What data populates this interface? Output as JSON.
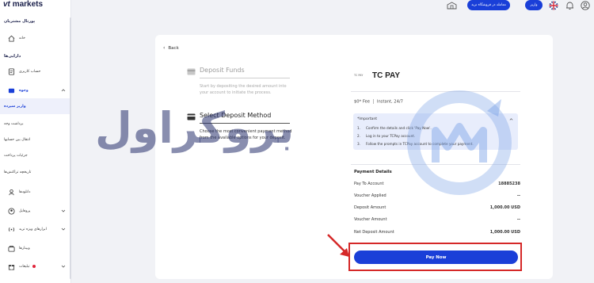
{
  "brand": {
    "logo_prefix": "vt",
    "logo_suffix": "markets"
  },
  "sidebar": {
    "portal_title": "پورتال مشتریان",
    "items": [
      {
        "label": "خانه",
        "icon": "home-icon"
      },
      {
        "heading": "دارایی‌ها"
      },
      {
        "label": "حساب کاربری",
        "icon": "account-icon"
      },
      {
        "label": "وجوه",
        "icon": "wallet-icon",
        "expandable": true
      },
      {
        "label": "واریز سپرده",
        "active": true
      },
      {
        "label": "برداشت وجه"
      },
      {
        "label": "انتقال بین حسابها"
      },
      {
        "label": "جزئیات پرداخت"
      },
      {
        "label": "تاریخچه تراکنش‌ها"
      },
      {
        "label": "دانلودها",
        "icon": "download-icon"
      },
      {
        "label": "پروفایل",
        "icon": "profile-icon",
        "expandable": true
      },
      {
        "label": "ابزارهای ویژه ترید",
        "icon": "signal-icon",
        "expandable": true
      },
      {
        "label": "وبینارها",
        "icon": "webinar-icon"
      },
      {
        "label": "تبلیغات",
        "icon": "gift-icon",
        "expandable": true,
        "badge_color": "#e0243b"
      }
    ]
  },
  "topbar": {
    "trade_button": "معامله در فروشگاه ترید",
    "deposit_button": "واریز",
    "language": "English",
    "notifications_icon": "bell-icon",
    "user_icon": "user-circle-icon"
  },
  "card": {
    "back_label": "Back",
    "steps": [
      {
        "title": "Deposit Funds",
        "description": "Start by depositing the desired amount into your account to initiate the process.",
        "active": false
      },
      {
        "title": "Select Deposit Method",
        "description": "Choose the most convenient payment method from the available options for your deposit.",
        "active": true
      }
    ],
    "method": {
      "logo_text": "TC PAY",
      "name": "TC PAY",
      "fee": "$0* Fee",
      "speed": "Instant, 24/7"
    },
    "important": {
      "title": "*Important",
      "steps": [
        {
          "n": "1.",
          "text": "Confirm the details and click 'Pay Now'."
        },
        {
          "n": "2.",
          "text": "Log in to your TCPay account."
        },
        {
          "n": "3.",
          "text": "Follow the prompts in TCPay account to complete your payment."
        }
      ]
    },
    "payment_details": {
      "title": "Payment Details",
      "rows": [
        {
          "label": "Pay To Account",
          "value": "18885238"
        },
        {
          "label": "Voucher Applied",
          "value": "--"
        },
        {
          "label": "Deposit Amount",
          "value": "1,000.00 USD"
        },
        {
          "label": "Voucher Amount",
          "value": "--"
        },
        {
          "label": "Net Deposit Amount",
          "value": "1,000.00 USD"
        }
      ]
    },
    "pay_button": "Pay Now"
  },
  "watermark": "بروکراول",
  "colors": {
    "accent": "#1a3fd8",
    "highlight_box": "#d52828",
    "important_bg": "#e8edfc"
  }
}
